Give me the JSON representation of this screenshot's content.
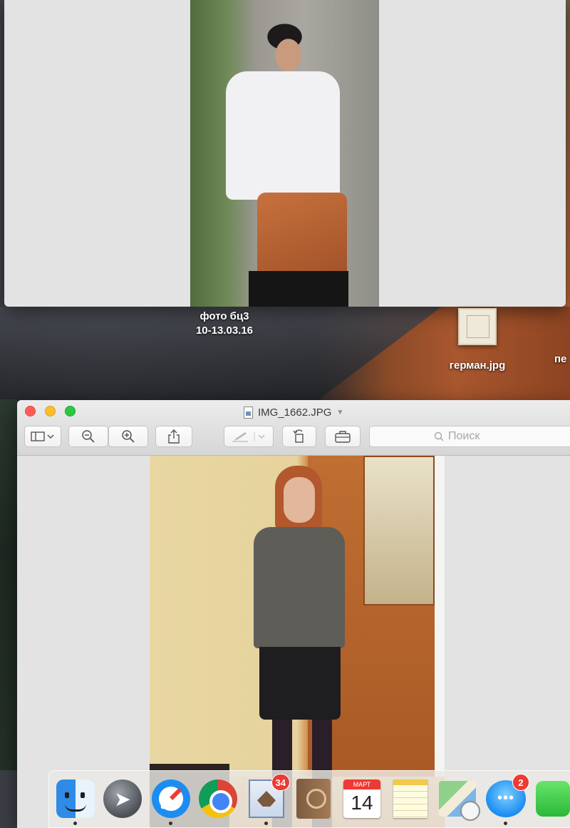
{
  "desktop": {
    "folder_label_line1": "фото бц3",
    "folder_label_line2": "10-13.03.16",
    "file_label": "герман.jpg",
    "cut_label": "пе"
  },
  "preview_window": {
    "title": "IMG_1662.JPG",
    "search_placeholder": "Поиск",
    "toolbar": {
      "sidebar_icon": "sidebar-icon",
      "zoom_out_icon": "zoom-out-icon",
      "zoom_in_icon": "zoom-in-icon",
      "share_icon": "share-icon",
      "markup_icon": "pen-icon",
      "rotate_icon": "rotate-icon",
      "toolbox_icon": "toolbox-icon"
    }
  },
  "dock": {
    "items": [
      {
        "name": "Finder",
        "icon": "finder-icon",
        "running": true
      },
      {
        "name": "Launchpad",
        "icon": "launchpad-icon",
        "running": false
      },
      {
        "name": "Safari",
        "icon": "safari-icon",
        "running": true
      },
      {
        "name": "Chrome",
        "icon": "chrome-icon",
        "running": false
      },
      {
        "name": "Mail",
        "icon": "mail-icon",
        "running": true,
        "badge": "34"
      },
      {
        "name": "Contacts",
        "icon": "contacts-icon",
        "running": false
      },
      {
        "name": "Calendar",
        "icon": "calendar-icon",
        "running": false,
        "month": "МАРТ",
        "day": "14"
      },
      {
        "name": "Notes",
        "icon": "notes-icon",
        "running": false
      },
      {
        "name": "Maps",
        "icon": "maps-icon",
        "running": false
      },
      {
        "name": "Messages",
        "icon": "messages-icon",
        "running": true,
        "badge": "2"
      },
      {
        "name": "FaceTime",
        "icon": "facetime-icon",
        "running": false
      }
    ]
  },
  "colors": {
    "close": "#fd5e56",
    "minimize": "#fdbc2e",
    "maximize": "#2ac840",
    "badge": "#ee3a32"
  }
}
